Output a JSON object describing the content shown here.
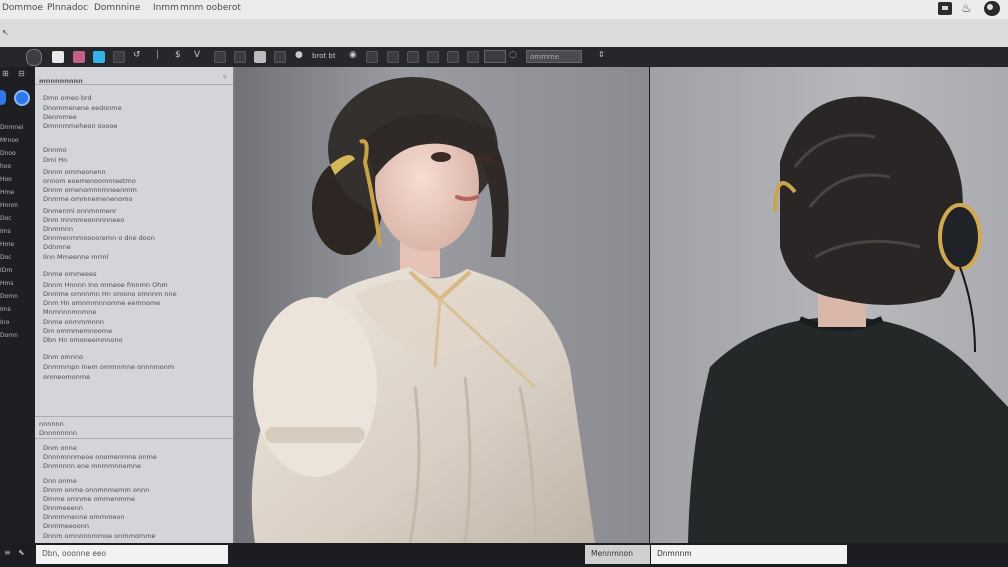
{
  "menubar": {
    "items": [
      "Dommoe",
      "Plnnadoc",
      "Domnnine",
      "Inmm",
      "mnm ooberot"
    ]
  },
  "toolbar": {
    "tool_text_1": "brot bt",
    "tool_text_2": "ommme"
  },
  "rail": {
    "labels": [
      "Dnmnei",
      "Mrnoo",
      "Dnoo",
      "hoo",
      "Hoo",
      "Hme",
      "Hnnm",
      "Doc",
      "Ims",
      "Hme",
      "Doc",
      "IDm",
      "Hms",
      "Domn",
      "Ims",
      "Ino",
      "Domn"
    ]
  },
  "panel": {
    "header": "mnnnnnnnn",
    "lines": [
      "Dmn omeo brd",
      "Dnommenene eedonme",
      "Denmmee",
      "Dmnnmmeheon ooooe",
      "Dnnmo",
      "Dmi Hn",
      "Dnnm ommeonenn",
      "onnom eoemenoomnreetmo",
      "Dnnm omenomnnmneenmm",
      "Dnmme ommnemenenomo",
      "Dnmenmi onnmnmenr",
      "Dnm mnmmeonnnnneeo",
      "Dnmmnn",
      "Dnnmenmmooooremn o dne doon",
      "Ddnmne",
      "Iinn Mmeenne mrml",
      "Dnme ommeees",
      "Dnnm Hnnnn Ino mmeoe fmnmn Ohm",
      "Dnmme omnnmn Hn omono omnnm nne",
      "Dnm Hn omnmmnnomne eemnome",
      "Mnmnnnmnmne",
      "Dnme onmmmnnn",
      "Dm ommmemnoome",
      "Dbn Hn omoneemnnono",
      "Dnm omnno",
      "Dnmmmpn Inem ommnmne onnnmonm",
      "onmeomonme"
    ],
    "section_header": "nnnnnn",
    "section_title": "Dnnnnnnnn",
    "section_lines": [
      "Dnm onne",
      "Dnnnmnnmeoe onomenmne onme",
      "Dnmnnnn ene mnmmnnemne",
      "Dnn onme",
      "Dnnm onme onnmnmemm onnn",
      "Dmme omnme ommenmme",
      "Dnnmeeenn",
      "Dnmmmenne ommmeon",
      "Dnmmeeoonn",
      "Dnnm omnnnnmmoe onmmomme"
    ]
  },
  "bottombar": {
    "left_field": "Dbn, ooonne eeo",
    "right_label": "Mennmnon",
    "right_field": "Dnmnnm"
  },
  "colors": {
    "background": "#1c1d20",
    "menubar": "#ececec",
    "toolbar": "#26272b",
    "panel": "#d4d5da",
    "accent_blue": "#2f78e8",
    "accent_cyan": "#35b3e6",
    "accent_pink": "#c65f86"
  }
}
